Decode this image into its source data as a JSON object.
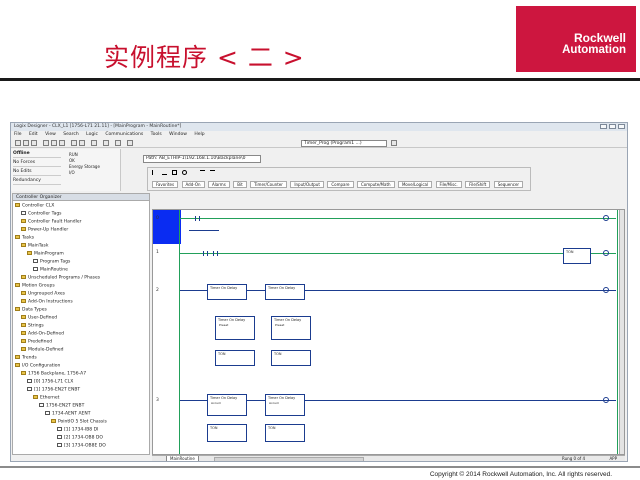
{
  "slide": {
    "title": "实例程序 < 二 >",
    "logo_line1": "Rockwell",
    "logo_line2": "Automation",
    "copyright": "Copyright © 2014 Rockwell Automation, Inc. All rights reserved."
  },
  "window": {
    "title": "Logix Designer - CLX_L1 [1756-L71 21.11] - [MainProgram - MainRoutine*]",
    "menus": [
      "File",
      "Edit",
      "View",
      "Search",
      "Logic",
      "Communications",
      "Tools",
      "Window",
      "Help"
    ],
    "path_combo": "Path:  AB_ETHIP-1\\192.168.1.10\\Backplane\\0",
    "toolbar_combo": "Timer_Prog (Program1 ...)"
  },
  "status_panel": {
    "rows": [
      "Offline",
      "No Forces",
      "No Edits",
      "Redundancy"
    ],
    "flags": [
      "RUN",
      "OK",
      "Energy Storage",
      "I/O"
    ]
  },
  "ladder_tabs": [
    "Favorites",
    "Add-On",
    "Alarms",
    "Bit",
    "Timer/Counter",
    "Input/Output",
    "Compare",
    "Compute/Math",
    "Move/Logical",
    "File/Misc.",
    "File/Shift",
    "Sequencer"
  ],
  "organizer": {
    "title": "Controller Organizer",
    "items": [
      {
        "label": "Controller CLX",
        "icon": "folder-icon"
      },
      {
        "label": "Controller Tags",
        "icon": "file-icon"
      },
      {
        "label": "Controller Fault Handler",
        "icon": "folder-icon"
      },
      {
        "label": "Power-Up Handler",
        "icon": "folder-icon"
      },
      {
        "label": "Tasks",
        "icon": "folder-icon"
      },
      {
        "label": "MainTask",
        "icon": "folder-icon"
      },
      {
        "label": "MainProgram",
        "icon": "folder-icon"
      },
      {
        "label": "Program Tags",
        "icon": "file-icon"
      },
      {
        "label": "MainRoutine",
        "icon": "file-icon"
      },
      {
        "label": "Unscheduled Programs / Phases",
        "icon": "folder-icon"
      },
      {
        "label": "Motion Groups",
        "icon": "folder-icon"
      },
      {
        "label": "Ungrouped Axes",
        "icon": "folder-icon"
      },
      {
        "label": "Add-On Instructions",
        "icon": "folder-icon"
      },
      {
        "label": "Data Types",
        "icon": "folder-icon"
      },
      {
        "label": "User-Defined",
        "icon": "folder-icon"
      },
      {
        "label": "Strings",
        "icon": "folder-icon"
      },
      {
        "label": "Add-On-Defined",
        "icon": "folder-icon"
      },
      {
        "label": "Predefined",
        "icon": "folder-icon"
      },
      {
        "label": "Module-Defined",
        "icon": "folder-icon"
      },
      {
        "label": "Trends",
        "icon": "folder-icon"
      },
      {
        "label": "I/O Configuration",
        "icon": "folder-icon"
      },
      {
        "label": "1756 Backplane, 1756-A7",
        "icon": "folder-icon"
      },
      {
        "label": "[0] 1756-L71 CLX",
        "icon": "file-icon"
      },
      {
        "label": "[1] 1756-EN2T ENBT",
        "icon": "file-icon"
      },
      {
        "label": "Ethernet",
        "icon": "folder-icon"
      },
      {
        "label": "1756-EN2T ENBT",
        "icon": "file-icon"
      },
      {
        "label": "1734-AENT AENT",
        "icon": "file-icon"
      },
      {
        "label": "PointIO 5 Slot Chassis",
        "icon": "folder-icon"
      },
      {
        "label": "[1] 1734-IB8 DI",
        "icon": "file-icon"
      },
      {
        "label": "[2] 1734-OB8 DO",
        "icon": "file-icon"
      },
      {
        "label": "[3] 1734-OB8E DO",
        "icon": "file-icon"
      }
    ]
  },
  "ladder": {
    "rungs": [
      "0",
      "1",
      "2",
      "3"
    ],
    "sheet_tab": "MainRoutine",
    "rung_status": "Rung 0 of 4",
    "status_right": "APP",
    "timer_labels": [
      "Timer On Delay",
      "TON",
      "Preset",
      "Accum"
    ]
  }
}
